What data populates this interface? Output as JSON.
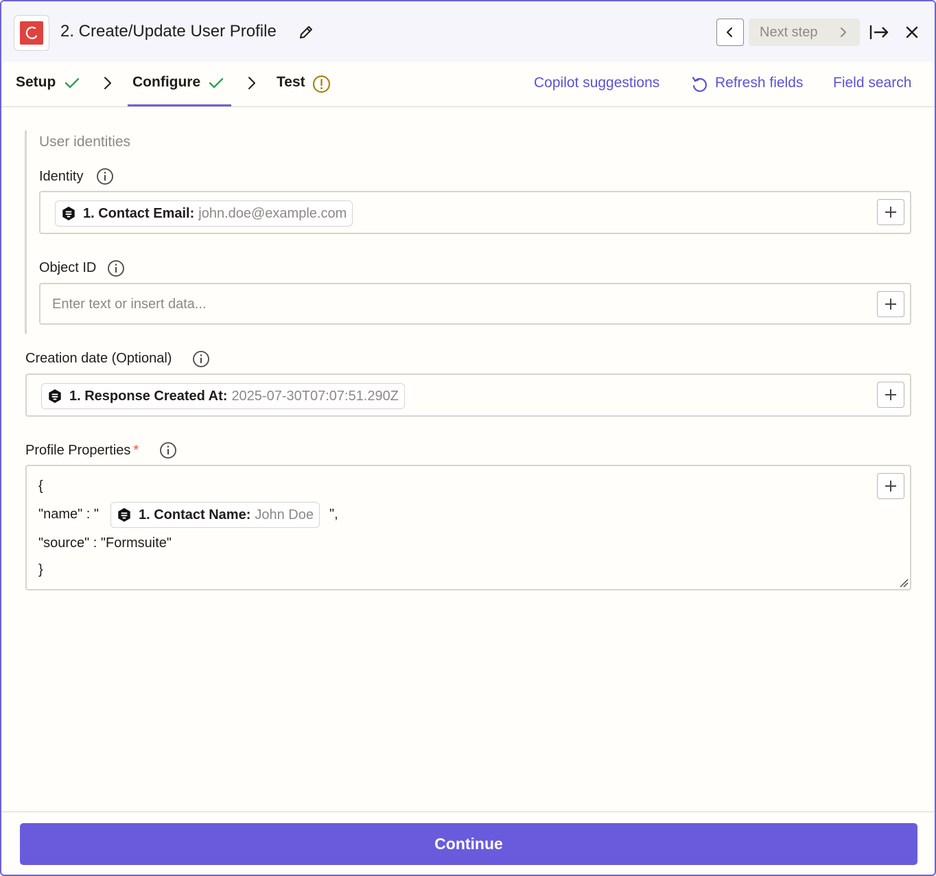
{
  "header": {
    "step_title": "2. Create/Update User Profile",
    "next_step_label": "Next step"
  },
  "tabs": [
    {
      "label": "Setup",
      "status": "complete"
    },
    {
      "label": "Configure",
      "status": "complete",
      "active": true
    },
    {
      "label": "Test",
      "status": "warning"
    }
  ],
  "actions": {
    "copilot": "Copilot suggestions",
    "refresh": "Refresh fields",
    "field_search": "Field search"
  },
  "form": {
    "group_title": "User identities",
    "identity": {
      "label": "Identity",
      "pill_key": "1. Contact Email:",
      "pill_value": "john.doe@example.com"
    },
    "object_id": {
      "label": "Object ID",
      "placeholder": "Enter text or insert data..."
    },
    "creation_date": {
      "label": "Creation date (Optional)",
      "pill_key": "1. Response Created At:",
      "pill_value": "2025-07-30T07:07:51.290Z"
    },
    "profile_properties": {
      "label": "Profile Properties",
      "required_mark": "*",
      "line1": "{",
      "line2_prefix": "\"name\" : \"",
      "pill_key": "1. Contact Name:",
      "pill_value": "John Doe",
      "line2_suffix": "\",",
      "line3": "\"source\" : \"Formsuite\"",
      "line4": "}"
    }
  },
  "footer": {
    "continue_label": "Continue"
  },
  "colors": {
    "accent": "#6b63d9",
    "button": "#695bdc",
    "link": "#5b52d6",
    "check": "#2e9e4f",
    "warning": "#a88612",
    "required": "#e4572e",
    "app_brand": "#e0433f"
  }
}
